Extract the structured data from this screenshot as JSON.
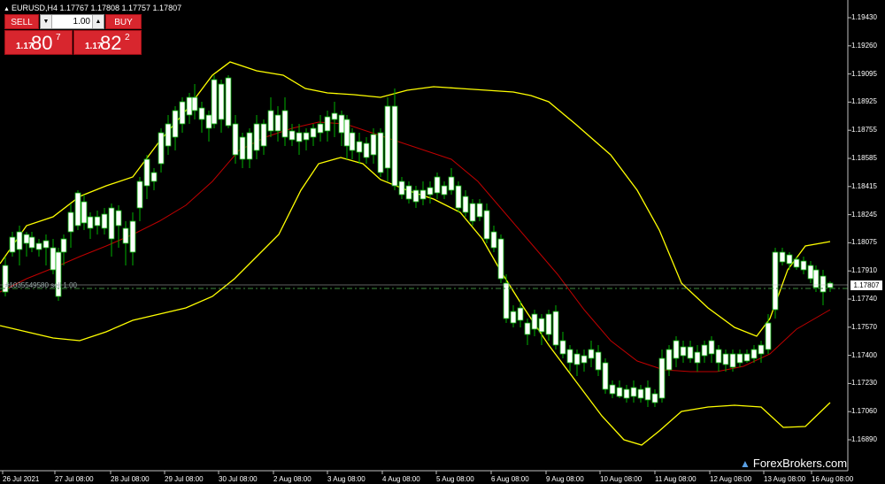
{
  "title": "EURUSD,H4  1.17767 1.17808 1.17757 1.17807",
  "trade_panel": {
    "sell_label": "SELL",
    "buy_label": "BUY",
    "lot_value": "1.00",
    "sell_price": {
      "prefix": "1.17",
      "main": "80",
      "sup": "7"
    },
    "buy_price": {
      "prefix": "1.17",
      "main": "82",
      "sup": "2"
    }
  },
  "price_axis": [
    "1.19430",
    "1.19260",
    "1.19095",
    "1.18925",
    "1.18755",
    "1.18585",
    "1.18415",
    "1.18245",
    "1.18075",
    "1.17910",
    "1.17740",
    "1.17570",
    "1.17400",
    "1.17230",
    "1.17060",
    "1.16890"
  ],
  "current_price": "1.17807",
  "hline_label": "#1035549580 sell 1.00",
  "date_axis": [
    "26 Jul 2021",
    "27 Jul 08:00",
    "28 Jul 08:00",
    "29 Jul 08:00",
    "30 Jul 08:00",
    "2 Aug 08:00",
    "3 Aug 08:00",
    "4 Aug 08:00",
    "5 Aug 08:00",
    "6 Aug 08:00",
    "9 Aug 08:00",
    "10 Aug 08:00",
    "11 Aug 08:00",
    "12 Aug 08:00",
    "13 Aug 08:00",
    "16 Aug 08:00"
  ],
  "watermark": "ForexBrokers.com",
  "colors": {
    "bull": "#ffffff",
    "bear": "#ffffff",
    "wick": "#00b000",
    "bands": "#ffff00",
    "mid": "#c00000",
    "grid_line": "#c0c0c0"
  }
}
